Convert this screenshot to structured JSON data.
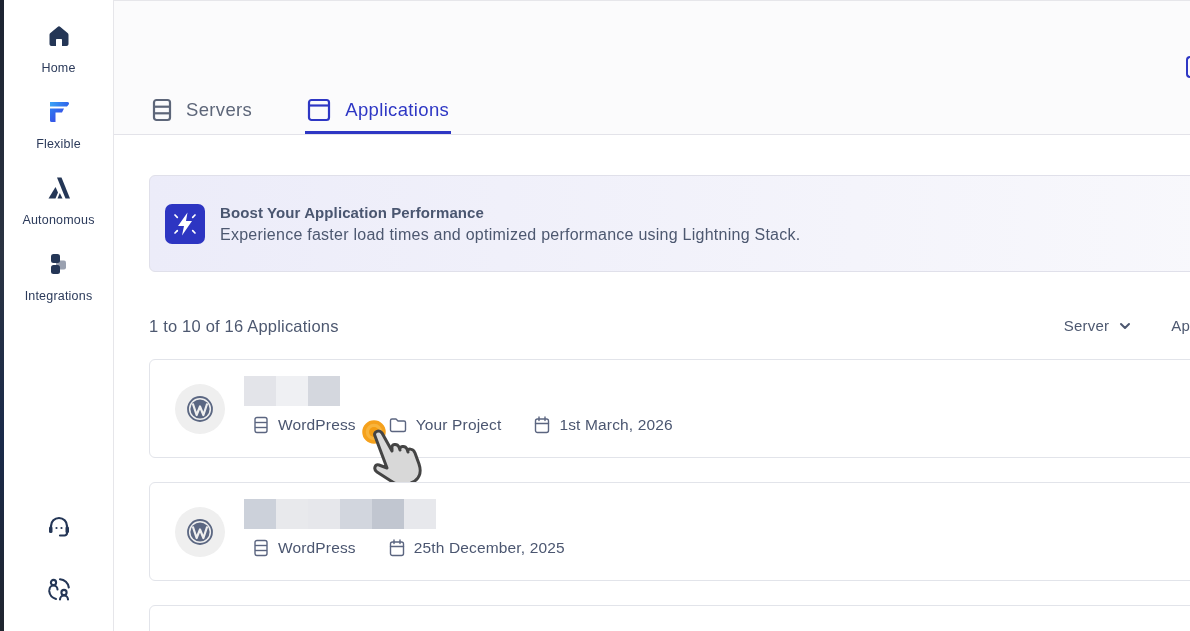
{
  "sidebar": {
    "items": [
      {
        "label": "Home"
      },
      {
        "label": "Flexible"
      },
      {
        "label": "Autonomous"
      },
      {
        "label": "Integrations"
      }
    ]
  },
  "tabs": [
    {
      "label": "Servers",
      "selected": false
    },
    {
      "label": "Applications",
      "selected": true
    }
  ],
  "banner": {
    "title": "Boost Your Application Performance",
    "text": "Experience faster load times and optimized performance using Lightning Stack."
  },
  "summary": "1 to 10 of 16 Applications",
  "filters": [
    {
      "label": "Server",
      "dropdown": true
    },
    {
      "label": "Ap",
      "dropdown": false
    }
  ],
  "applications": [
    {
      "name_tiles": [
        {
          "color": "#e3e4e9"
        },
        {
          "color": "#eff0f3"
        },
        {
          "color": "#d4d7de"
        }
      ],
      "meta": [
        {
          "kind": "platform",
          "text": "WordPress"
        },
        {
          "kind": "project",
          "text": "Your Project"
        },
        {
          "kind": "date",
          "text": "1st March, 2026"
        }
      ]
    },
    {
      "name_tiles": [
        {
          "color": "#ccd1da"
        },
        {
          "color": "#e8e9ec"
        },
        {
          "color": "#e6e7eb"
        },
        {
          "color": "#d2d6de"
        },
        {
          "color": "#c1c6d0"
        },
        {
          "color": "#e7e8ec"
        }
      ],
      "meta": [
        {
          "kind": "platform",
          "text": "WordPress"
        },
        {
          "kind": "date",
          "text": "25th December, 2025"
        }
      ]
    }
  ],
  "list_continues": true
}
